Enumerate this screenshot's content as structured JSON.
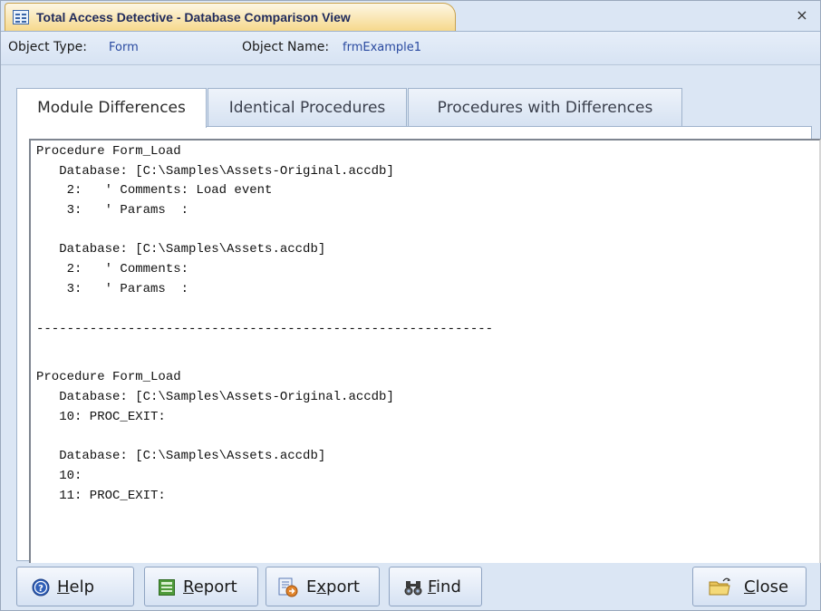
{
  "window": {
    "title": "Total Access Detective - Database Comparison View",
    "close_glyph": "×"
  },
  "info": {
    "object_type_label": "Object Type:",
    "object_type_value": "Form",
    "object_name_label": "Object Name:",
    "object_name_value": "frmExample1"
  },
  "tabs": [
    {
      "label": "Module Differences",
      "active": true
    },
    {
      "label": "Identical Procedures",
      "active": false
    },
    {
      "label": "Procedures with Differences",
      "active": false
    }
  ],
  "code_lines": [
    "Procedure Form_Load",
    "   Database: [C:\\Samples\\Assets-Original.accdb]",
    "    2:   ' Comments: Load event",
    "    3:   ' Params  :",
    "",
    "   Database: [C:\\Samples\\Assets.accdb]",
    "    2:   ' Comments:",
    "    3:   ' Params  :",
    "",
    "------------------------------------------------------------",
    "",
    "",
    "Procedure Form_Load",
    "   Database: [C:\\Samples\\Assets-Original.accdb]",
    "   10: PROC_EXIT:",
    "",
    "   Database: [C:\\Samples\\Assets.accdb]",
    "   10:",
    "   11: PROC_EXIT:"
  ],
  "buttons": {
    "help": {
      "prefix": "",
      "accel": "H",
      "rest": "elp",
      "icon": "help-icon"
    },
    "report": {
      "prefix": "",
      "accel": "R",
      "rest": "eport",
      "icon": "report-icon"
    },
    "export": {
      "prefix": "E",
      "accel": "x",
      "rest": "port",
      "icon": "export-icon"
    },
    "find": {
      "prefix": "",
      "accel": "F",
      "rest": "ind",
      "icon": "binoculars-icon"
    },
    "close": {
      "prefix": "",
      "accel": "C",
      "rest": "lose",
      "icon": "folder-close-icon"
    }
  },
  "colors": {
    "title_tab": "#f6d98c",
    "accent_blue": "#2a4aa0",
    "window_bg": "#dbe6f4"
  }
}
